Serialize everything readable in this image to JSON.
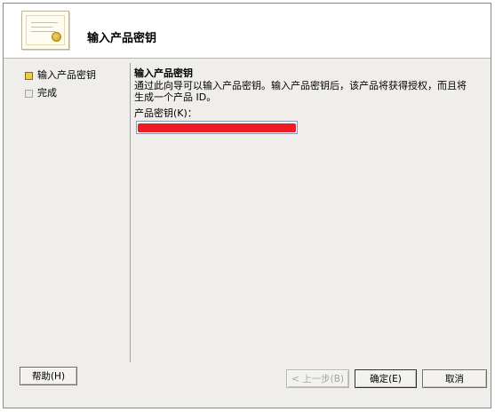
{
  "header": {
    "title": "输入产品密钥"
  },
  "steps": [
    {
      "label": "输入产品密钥",
      "active": true
    },
    {
      "label": "完成",
      "active": false
    }
  ],
  "content": {
    "title": "输入产品密钥",
    "description": "通过此向导可以输入产品密钥。输入产品密钥后，该产品将获得授权，而且将生成一个产品 ID。",
    "key_label": "产品密钥(K)：",
    "key_value": ""
  },
  "buttons": {
    "help": "帮助(H)",
    "back": "< 上一步(B)",
    "ok": "确定(E)",
    "cancel": "取消"
  },
  "colors": {
    "redaction": "#ee1c25",
    "active_step_bullet": "#f2c94c"
  },
  "icons": {
    "header": "certificate-icon"
  }
}
